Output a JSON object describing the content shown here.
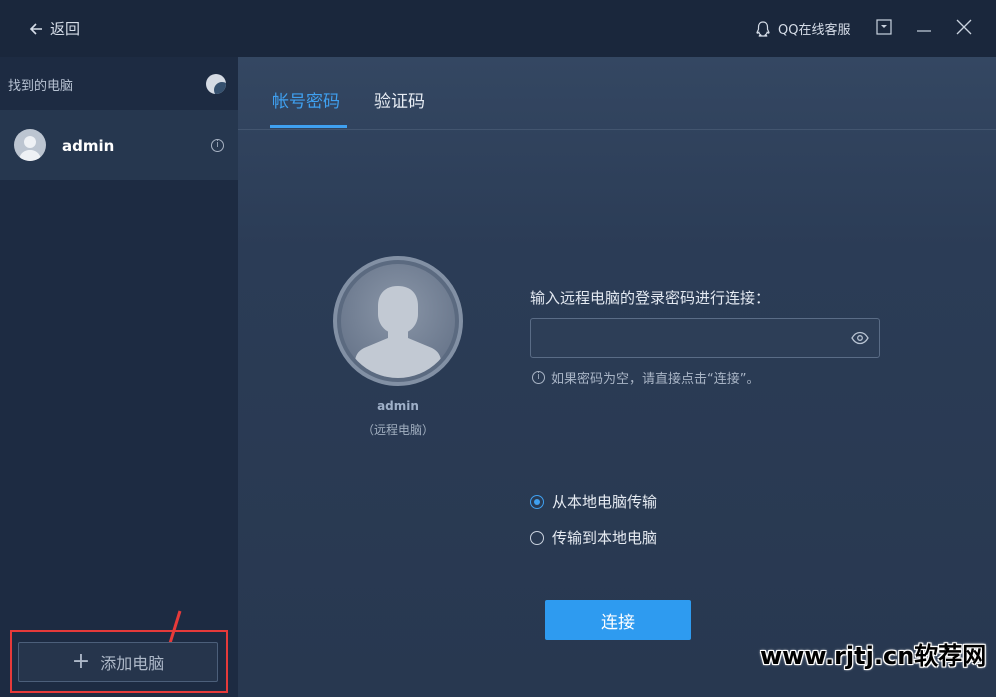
{
  "topbar": {
    "back_label": "返回",
    "support_label": "QQ在线客服"
  },
  "sidebar": {
    "header": "找到的电脑",
    "computers": [
      {
        "name": "admin"
      }
    ],
    "add_label": "添加电脑"
  },
  "tabs": [
    {
      "label": "帐号密码",
      "active": true
    },
    {
      "label": "验证码",
      "active": false
    }
  ],
  "remote": {
    "name": "admin",
    "subtitle": "（远程电脑）"
  },
  "login": {
    "prompt": "输入远程电脑的登录密码进行连接：",
    "password_value": "",
    "hint": "如果密码为空，请直接点击“连接”。"
  },
  "direction": {
    "options": [
      {
        "label": "从本地电脑传输",
        "selected": true
      },
      {
        "label": "传输到本地电脑",
        "selected": false
      }
    ]
  },
  "connect_label": "连接",
  "watermark": "www.rjtj.cn软荐网",
  "colors": {
    "accent": "#3fa0f0",
    "annotation": "#e63a3a"
  }
}
